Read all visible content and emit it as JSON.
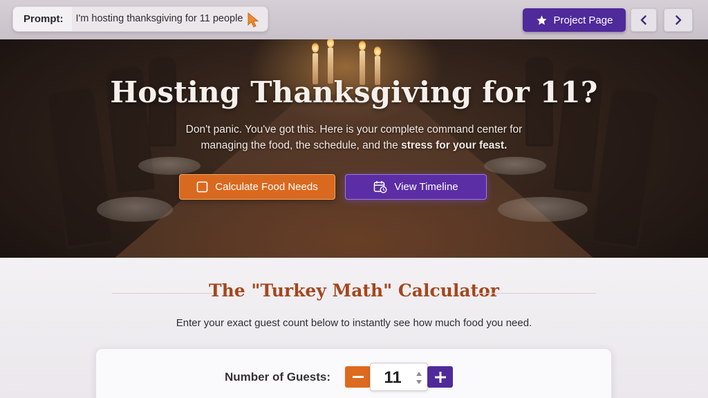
{
  "prompt": {
    "label": "Prompt:",
    "text": "I'm hosting thanksgiving for 11 people",
    "icon": "cursor-pointer-icon"
  },
  "toolbar": {
    "project_label": "Project Page",
    "project_icon": "star-icon",
    "prev_icon": "chevron-left-icon",
    "next_icon": "chevron-right-icon"
  },
  "hero": {
    "title": "Hosting Thanksgiving for 11?",
    "subtitle_line1": "Don't panic. You've got this. Here is your complete command center for",
    "subtitle_line2_plain": "managing the food, the schedule, and the ",
    "subtitle_line2_bold": "stress for your feast.",
    "calc_button": "Calculate Food Needs",
    "timeline_button": "View Timeline"
  },
  "calculator": {
    "title": "The \"Turkey Math\" Calculator",
    "description": "Enter your exact guest count below to instantly see how much food you need.",
    "guests_label": "Number of Guests:",
    "guests_value": "11"
  },
  "colors": {
    "accent_orange": "#d9691f",
    "accent_purple": "#4f2a9a",
    "title_rust": "#a5461c"
  }
}
